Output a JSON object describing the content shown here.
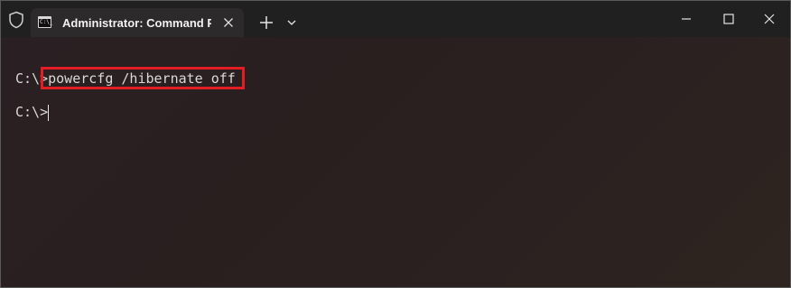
{
  "tab": {
    "title": "Administrator: Command Prompt",
    "icon_text": "C:\\_"
  },
  "terminal": {
    "lines": [
      {
        "prompt": "C:\\>",
        "command": "powercfg /hibernate off"
      },
      {
        "prompt": "C:\\>",
        "command": ""
      }
    ]
  },
  "colors": {
    "titlebar": "#202020",
    "tab": "#2c2a2a",
    "highlight_box": "#e21d24",
    "text": "#d9d9d9"
  },
  "icons": [
    "shield-icon",
    "terminal-icon",
    "close-icon",
    "plus-icon",
    "chevron-down-icon",
    "minimize-icon",
    "maximize-icon",
    "window-close-icon"
  ]
}
